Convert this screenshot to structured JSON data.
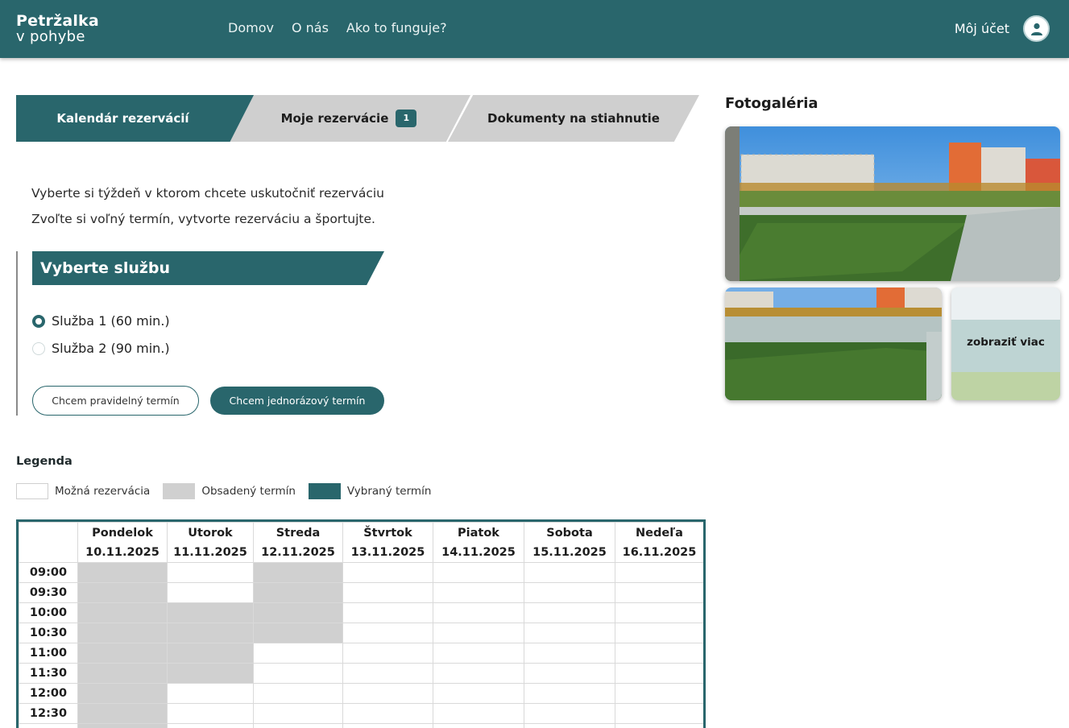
{
  "header": {
    "logo_line1": "Petržalka",
    "logo_line2": "v pohybe",
    "nav": [
      "Domov",
      "O nás",
      "Ako to funguje?"
    ],
    "account_label": "Môj účet"
  },
  "tabs": {
    "calendar": "Kalendár rezervácií",
    "my_reservations": "Moje rezervácie",
    "my_reservations_count": "1",
    "documents": "Dokumenty na stiahnutie"
  },
  "intro": {
    "line1": "Vyberte si týždeň v ktorom chcete uskutočniť rezerváciu",
    "line2": "Zvoľte si voľný termín, vytvorte rezerváciu a športujte."
  },
  "service": {
    "title": "Vyberte službu",
    "options": [
      "Služba 1 (60 min.)",
      "Služba 2 (90 min.)"
    ],
    "selected": 0,
    "btn_regular": "Chcem pravidelný termín",
    "btn_single": "Chcem jednorázový termín"
  },
  "legend": {
    "title": "Legenda",
    "items": [
      {
        "label": "Možná rezervácia",
        "color": "#ffffff"
      },
      {
        "label": "Obsadený termín",
        "color": "#d0d0d0"
      },
      {
        "label": "Vybraný termín",
        "color": "#29666c"
      }
    ]
  },
  "calendar": {
    "days": [
      {
        "name": "Pondelok",
        "date": "10.11.2025"
      },
      {
        "name": "Utorok",
        "date": "11.11.2025"
      },
      {
        "name": "Streda",
        "date": "12.11.2025"
      },
      {
        "name": "Štvrtok",
        "date": "13.11.2025"
      },
      {
        "name": "Piatok",
        "date": "14.11.2025"
      },
      {
        "name": "Sobota",
        "date": "15.11.2025"
      },
      {
        "name": "Nedeľa",
        "date": "16.11.2025"
      }
    ],
    "rows": [
      {
        "time": "09:00",
        "busy": [
          1,
          0,
          1,
          0,
          0,
          0,
          0
        ]
      },
      {
        "time": "09:30",
        "busy": [
          1,
          0,
          1,
          0,
          0,
          0,
          0
        ]
      },
      {
        "time": "10:00",
        "busy": [
          1,
          1,
          1,
          0,
          0,
          0,
          0
        ]
      },
      {
        "time": "10:30",
        "busy": [
          1,
          1,
          1,
          0,
          0,
          0,
          0
        ]
      },
      {
        "time": "11:00",
        "busy": [
          1,
          1,
          0,
          0,
          0,
          0,
          0
        ]
      },
      {
        "time": "11:30",
        "busy": [
          1,
          1,
          0,
          0,
          0,
          0,
          0
        ]
      },
      {
        "time": "12:00",
        "busy": [
          1,
          0,
          0,
          0,
          0,
          0,
          0
        ]
      },
      {
        "time": "12:30",
        "busy": [
          1,
          0,
          0,
          0,
          0,
          0,
          0
        ]
      },
      {
        "time": "",
        "busy": [
          1,
          0,
          0,
          0,
          0,
          0,
          0
        ]
      }
    ]
  },
  "gallery": {
    "title": "Fotogaléria",
    "more_label": "zobraziť viac"
  },
  "colors": {
    "primary": "#29666c",
    "busy": "#d0d0d0",
    "tab_inactive": "#cfcfcf"
  }
}
